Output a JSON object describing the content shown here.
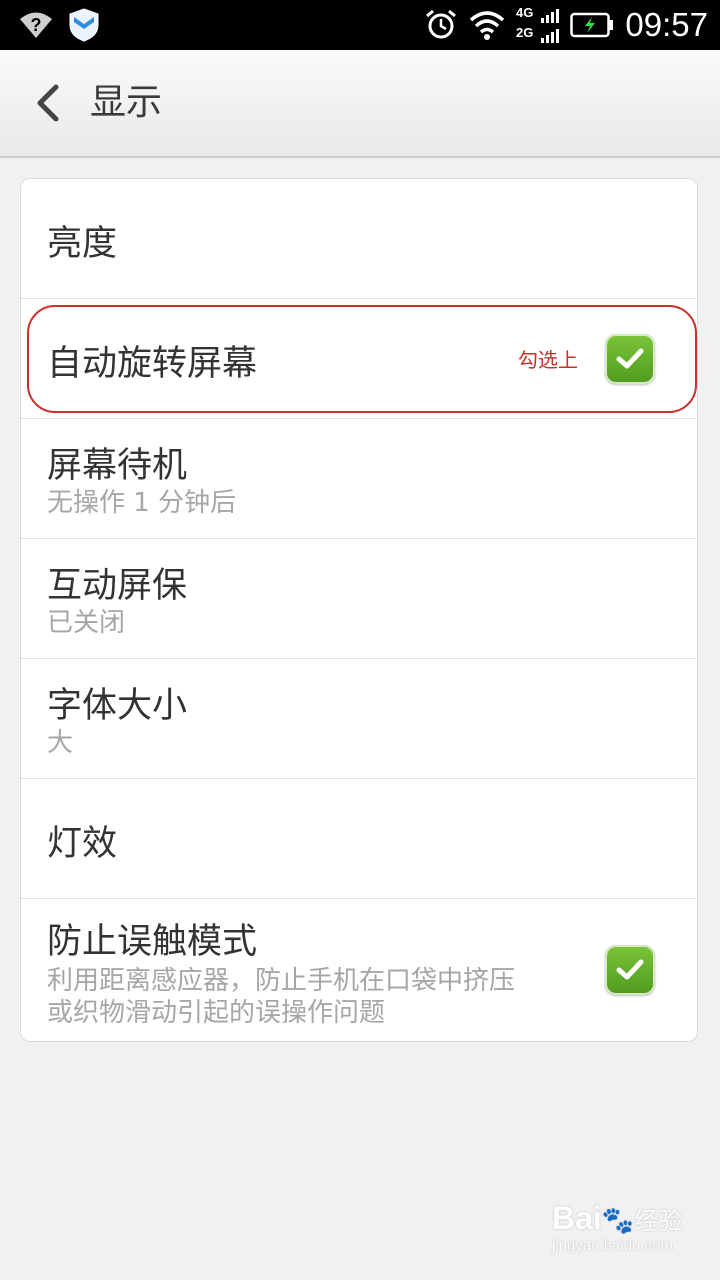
{
  "status_bar": {
    "time": "09:57",
    "network_top": "4G",
    "network_bottom": "2G",
    "icons": [
      "wifi-question-icon",
      "shield-icon",
      "alarm-icon",
      "wifi-icon",
      "signal-icon",
      "battery-icon"
    ]
  },
  "header": {
    "back_icon": "chevron-left-icon",
    "title": "显示"
  },
  "settings": [
    {
      "title": "亮度"
    },
    {
      "title": "自动旋转屏幕",
      "checked": true
    },
    {
      "title": "屏幕待机",
      "subtitle": "无操作 1 分钟后"
    },
    {
      "title": "互动屏保",
      "subtitle": "已关闭"
    },
    {
      "title": "字体大小",
      "subtitle": "大"
    },
    {
      "title": "灯效"
    },
    {
      "title": "防止误触模式",
      "subtitle_line1": "利用距离感应器，防止手机在口袋中挤压",
      "subtitle_line2": "或织物滑动引起的误操作问题",
      "checked": true
    }
  ],
  "annotation": {
    "text": "勾选上",
    "color": "#c9302c"
  },
  "watermark": {
    "main": "Bai",
    "suffix": "经验",
    "url": "jingyan.baidu.com"
  },
  "colors": {
    "accent_green": "#5aa82a",
    "background": "#f1f1f3"
  }
}
